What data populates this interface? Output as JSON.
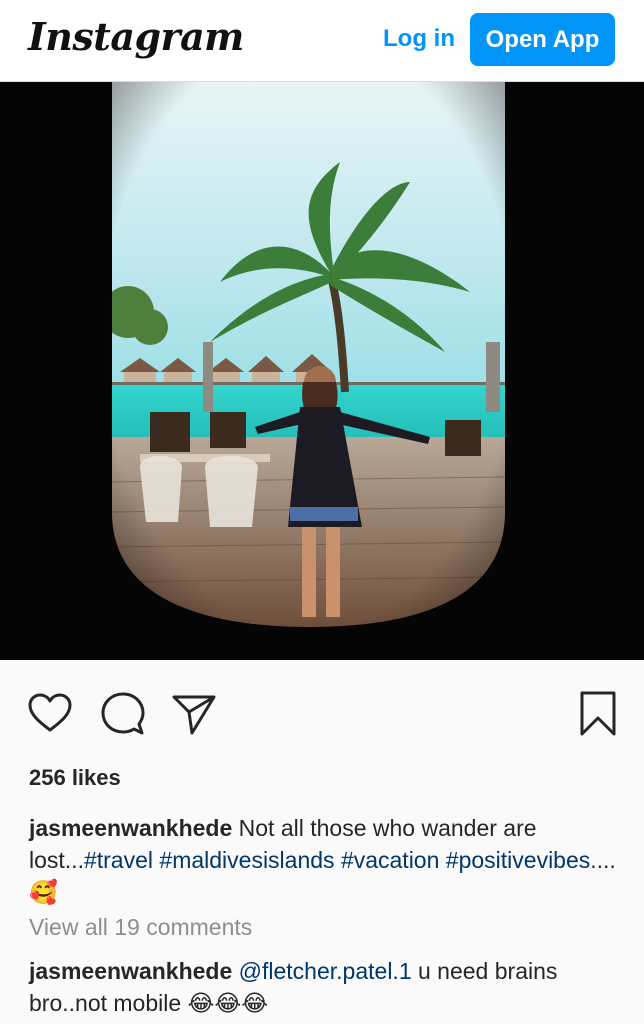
{
  "header": {
    "logo": "Instagram",
    "login_label": "Log in",
    "open_app_label": "Open App",
    "accent_color": "#0095f6"
  },
  "post": {
    "image_icon": "photo",
    "likes": "256 likes",
    "caption": {
      "username": "jasmeenwankhede",
      "text": " Not all those who wander are lost...",
      "hashtags": [
        "#travel",
        "#maldivesislands",
        "#vacation",
        "#positivevibes"
      ],
      "trailing": "....",
      "emoji": "🥰"
    },
    "view_comments": "View all 19 comments",
    "comment": {
      "username": "jasmeenwankhede",
      "mention": "@fletcher.patel.1",
      "text": " u need brains bro..not mobile ",
      "emoji": "😂😂😂"
    }
  },
  "icons": {
    "like": "heart-icon",
    "comment": "comment-icon",
    "share": "paper-plane-icon",
    "save": "bookmark-icon"
  }
}
